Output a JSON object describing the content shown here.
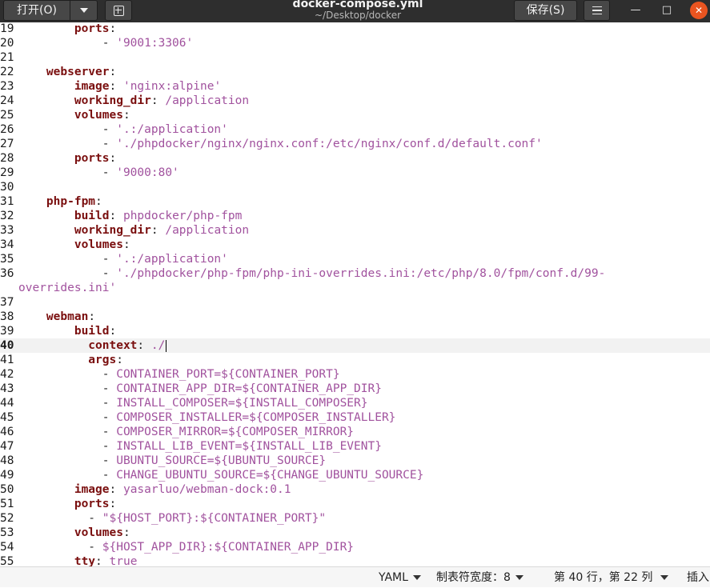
{
  "header": {
    "open_label": "打开(O)",
    "title": "docker-compose.yml",
    "subtitle": "~/Desktop/docker",
    "save_label": "保存(S)",
    "icons": {
      "open_menu": "chevron-down-icon",
      "new_tab": "new-tab-icon",
      "menu": "hamburger-menu-icon",
      "minimize": "minimize-icon",
      "maximize": "maximize-icon",
      "close": "close-icon"
    },
    "window_close_color": "#e95420"
  },
  "editor": {
    "current_line": "40",
    "lines": [
      {
        "n": "19",
        "tokens": [
          {
            "c": "k",
            "t": "        ports"
          },
          {
            "c": "p",
            "t": ":"
          }
        ]
      },
      {
        "n": "20",
        "tokens": [
          {
            "c": "p",
            "t": "            - "
          },
          {
            "c": "s",
            "t": "'9001:3306'"
          }
        ]
      },
      {
        "n": "21",
        "tokens": []
      },
      {
        "n": "22",
        "tokens": [
          {
            "c": "k",
            "t": "    webserver"
          },
          {
            "c": "p",
            "t": ":"
          }
        ]
      },
      {
        "n": "23",
        "tokens": [
          {
            "c": "k",
            "t": "        image"
          },
          {
            "c": "p",
            "t": ": "
          },
          {
            "c": "s",
            "t": "'nginx:alpine'"
          }
        ]
      },
      {
        "n": "24",
        "tokens": [
          {
            "c": "k",
            "t": "        working_dir"
          },
          {
            "c": "p",
            "t": ": "
          },
          {
            "c": "v",
            "t": "/application"
          }
        ]
      },
      {
        "n": "25",
        "tokens": [
          {
            "c": "k",
            "t": "        volumes"
          },
          {
            "c": "p",
            "t": ":"
          }
        ]
      },
      {
        "n": "26",
        "tokens": [
          {
            "c": "p",
            "t": "            - "
          },
          {
            "c": "s",
            "t": "'.:/application'"
          }
        ]
      },
      {
        "n": "27",
        "tokens": [
          {
            "c": "p",
            "t": "            - "
          },
          {
            "c": "s",
            "t": "'./phpdocker/nginx/nginx.conf:/etc/nginx/conf.d/default.conf'"
          }
        ]
      },
      {
        "n": "28",
        "tokens": [
          {
            "c": "k",
            "t": "        ports"
          },
          {
            "c": "p",
            "t": ":"
          }
        ]
      },
      {
        "n": "29",
        "tokens": [
          {
            "c": "p",
            "t": "            - "
          },
          {
            "c": "s",
            "t": "'9000:80'"
          }
        ]
      },
      {
        "n": "30",
        "tokens": []
      },
      {
        "n": "31",
        "tokens": [
          {
            "c": "k",
            "t": "    php-fpm"
          },
          {
            "c": "p",
            "t": ":"
          }
        ]
      },
      {
        "n": "32",
        "tokens": [
          {
            "c": "k",
            "t": "        build"
          },
          {
            "c": "p",
            "t": ": "
          },
          {
            "c": "v",
            "t": "phpdocker/php-fpm"
          }
        ]
      },
      {
        "n": "33",
        "tokens": [
          {
            "c": "k",
            "t": "        working_dir"
          },
          {
            "c": "p",
            "t": ": "
          },
          {
            "c": "v",
            "t": "/application"
          }
        ]
      },
      {
        "n": "34",
        "tokens": [
          {
            "c": "k",
            "t": "        volumes"
          },
          {
            "c": "p",
            "t": ":"
          }
        ]
      },
      {
        "n": "35",
        "tokens": [
          {
            "c": "p",
            "t": "            - "
          },
          {
            "c": "s",
            "t": "'.:/application'"
          }
        ]
      },
      {
        "n": "36",
        "tokens": [
          {
            "c": "p",
            "t": "            - "
          },
          {
            "c": "s",
            "t": "'./phpdocker/php-fpm/php-ini-overrides.ini:/etc/php/8.0/fpm/conf.d/99-"
          }
        ]
      },
      {
        "n": "",
        "wrap": true,
        "tokens": [
          {
            "c": "s",
            "t": "overrides.ini'"
          }
        ]
      },
      {
        "n": "37",
        "tokens": []
      },
      {
        "n": "38",
        "tokens": [
          {
            "c": "k",
            "t": "    webman"
          },
          {
            "c": "p",
            "t": ":"
          }
        ]
      },
      {
        "n": "39",
        "tokens": [
          {
            "c": "k",
            "t": "        build"
          },
          {
            "c": "p",
            "t": ":"
          }
        ]
      },
      {
        "n": "40",
        "current": true,
        "tokens": [
          {
            "c": "k",
            "t": "          context"
          },
          {
            "c": "p",
            "t": ": "
          },
          {
            "c": "v",
            "t": "./"
          }
        ]
      },
      {
        "n": "41",
        "tokens": [
          {
            "c": "k",
            "t": "          args"
          },
          {
            "c": "p",
            "t": ":"
          }
        ]
      },
      {
        "n": "42",
        "tokens": [
          {
            "c": "p",
            "t": "            - "
          },
          {
            "c": "v",
            "t": "CONTAINER_PORT=${CONTAINER_PORT}"
          }
        ]
      },
      {
        "n": "43",
        "tokens": [
          {
            "c": "p",
            "t": "            - "
          },
          {
            "c": "v",
            "t": "CONTAINER_APP_DIR=${CONTAINER_APP_DIR}"
          }
        ]
      },
      {
        "n": "44",
        "tokens": [
          {
            "c": "p",
            "t": "            - "
          },
          {
            "c": "v",
            "t": "INSTALL_COMPOSER=${INSTALL_COMPOSER}"
          }
        ]
      },
      {
        "n": "45",
        "tokens": [
          {
            "c": "p",
            "t": "            - "
          },
          {
            "c": "v",
            "t": "COMPOSER_INSTALLER=${COMPOSER_INSTALLER}"
          }
        ]
      },
      {
        "n": "46",
        "tokens": [
          {
            "c": "p",
            "t": "            - "
          },
          {
            "c": "v",
            "t": "COMPOSER_MIRROR=${COMPOSER_MIRROR}"
          }
        ]
      },
      {
        "n": "47",
        "tokens": [
          {
            "c": "p",
            "t": "            - "
          },
          {
            "c": "v",
            "t": "INSTALL_LIB_EVENT=${INSTALL_LIB_EVENT}"
          }
        ]
      },
      {
        "n": "48",
        "tokens": [
          {
            "c": "p",
            "t": "            - "
          },
          {
            "c": "v",
            "t": "UBUNTU_SOURCE=${UBUNTU_SOURCE}"
          }
        ]
      },
      {
        "n": "49",
        "tokens": [
          {
            "c": "p",
            "t": "            - "
          },
          {
            "c": "v",
            "t": "CHANGE_UBUNTU_SOURCE=${CHANGE_UBUNTU_SOURCE}"
          }
        ]
      },
      {
        "n": "50",
        "tokens": [
          {
            "c": "k",
            "t": "        image"
          },
          {
            "c": "p",
            "t": ": "
          },
          {
            "c": "v",
            "t": "yasarluo/webman-dock:0.1"
          }
        ]
      },
      {
        "n": "51",
        "tokens": [
          {
            "c": "k",
            "t": "        ports"
          },
          {
            "c": "p",
            "t": ":"
          }
        ]
      },
      {
        "n": "52",
        "tokens": [
          {
            "c": "p",
            "t": "          - "
          },
          {
            "c": "s",
            "t": "\"${HOST_PORT}:${CONTAINER_PORT}\""
          }
        ]
      },
      {
        "n": "53",
        "tokens": [
          {
            "c": "k",
            "t": "        volumes"
          },
          {
            "c": "p",
            "t": ":"
          }
        ]
      },
      {
        "n": "54",
        "tokens": [
          {
            "c": "p",
            "t": "          - "
          },
          {
            "c": "v",
            "t": "${HOST_APP_DIR}:${CONTAINER_APP_DIR}"
          }
        ]
      },
      {
        "n": "55",
        "tokens": [
          {
            "c": "k",
            "t": "        tty"
          },
          {
            "c": "p",
            "t": ": "
          },
          {
            "c": "v",
            "t": "true"
          }
        ]
      }
    ]
  },
  "statusbar": {
    "language": "YAML",
    "tab_width": "制表符宽度：8",
    "position": "第 40 行，第 22 列",
    "mode": "插入"
  }
}
